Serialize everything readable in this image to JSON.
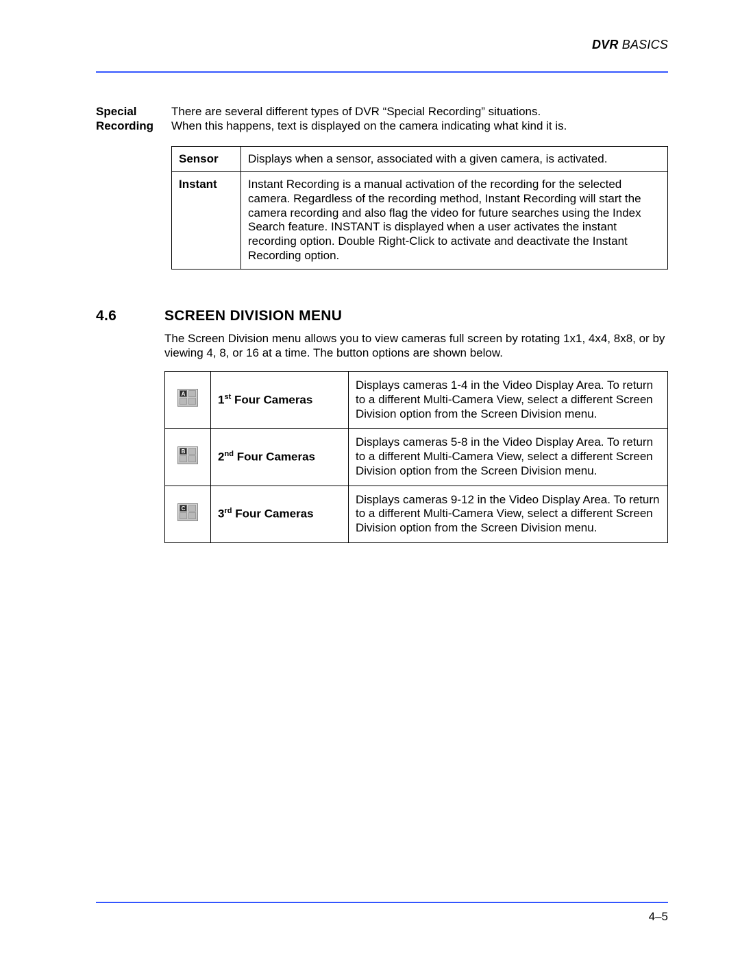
{
  "header": {
    "bold": "DVR",
    "rest": " BASICS"
  },
  "special": {
    "side_label": "Special Recording",
    "intro_line1": "There are several different types of DVR “Special Recording” situations.",
    "intro_line2": "When this happens, text is displayed on the camera indicating what kind it is.",
    "rows": [
      {
        "label": "Sensor",
        "desc": "Displays when a sensor, associated with a given camera, is activated."
      },
      {
        "label": "Instant",
        "desc": "Instant Recording is a manual activation of the recording for the selected camera. Regardless of the recording method, Instant Recording will start the camera recording and also flag the video for future searches using the Index Search feature. INSTANT is displayed when a user activates the instant recording option. Double Right-Click to activate and deactivate the Instant Recording option."
      }
    ]
  },
  "section": {
    "num": "4.6",
    "title": "SCREEN DIVISION MENU",
    "intro": "The Screen Division menu allows you to view cameras full screen by rotating 1x1, 4x4, 8x8, or by viewing 4, 8, or 16 at a time. The button options are shown below.",
    "rows": [
      {
        "tag": "A",
        "ord_num": "1",
        "ord_sup": "st",
        "name_rest": " Four Cameras",
        "desc": "Displays cameras 1-4 in the Video Display Area. To return to a different Multi-Camera View, select a different Screen Division option from the Screen Division menu."
      },
      {
        "tag": "B",
        "ord_num": "2",
        "ord_sup": "nd",
        "name_rest": " Four Cameras",
        "desc": "Displays cameras 5-8 in the Video Display Area. To return to a different Multi-Camera View, select a different Screen Division option from the Screen Division menu."
      },
      {
        "tag": "C",
        "ord_num": "3",
        "ord_sup": "rd",
        "name_rest": " Four Cameras",
        "desc": "Displays cameras 9-12 in the Video Display Area. To return to a different Multi-Camera View, select a different Screen Division option from the Screen Division menu."
      }
    ]
  },
  "footer": {
    "page": "4–5"
  }
}
